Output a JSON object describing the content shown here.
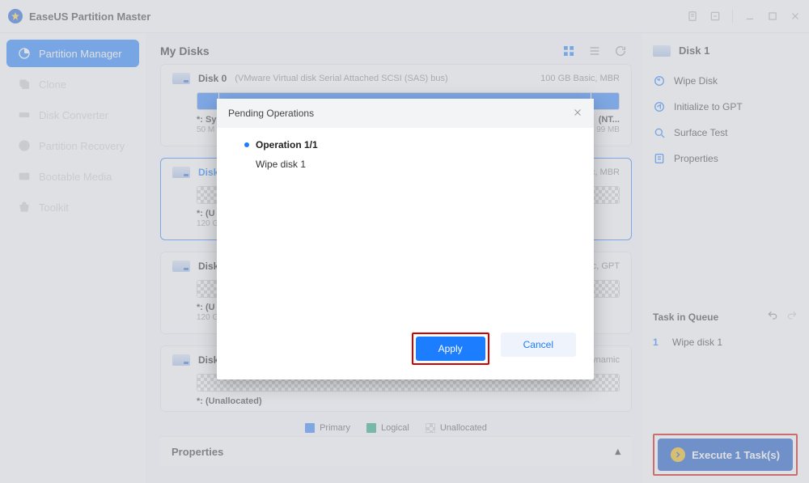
{
  "app": {
    "title": "EaseUS Partition Master"
  },
  "sidebar": {
    "items": [
      {
        "label": "Partition Manager",
        "icon": "pie"
      },
      {
        "label": "Clone",
        "icon": "clone"
      },
      {
        "label": "Disk Converter",
        "icon": "convert"
      },
      {
        "label": "Partition Recovery",
        "icon": "recovery"
      },
      {
        "label": "Bootable Media",
        "icon": "media"
      },
      {
        "label": "Toolkit",
        "icon": "toolkit"
      }
    ]
  },
  "main": {
    "title": "My Disks",
    "disks": [
      {
        "name": "Disk 0",
        "sub": "(VMware   Virtual disk     Serial Attached SCSI (SAS) bus)",
        "meta": "100 GB Basic, MBR",
        "lab1_name": "*: Sy",
        "lab1_size": "50 M",
        "lab2_name": "(NT...",
        "lab2_size": "99 MB"
      },
      {
        "name": "Disk",
        "meta": "sic, MBR",
        "lab1_name": "*: (U",
        "lab1_size": "120 G"
      },
      {
        "name": "Disk",
        "meta": "asic, GPT",
        "lab1_name": "*: (U",
        "lab1_size": "120 G"
      },
      {
        "name": "Disk",
        "meta": "Dynamic",
        "lab1_name": "*: (Unallocated)",
        "lab1_size": ""
      }
    ],
    "legend": {
      "primary": "Primary",
      "logical": "Logical",
      "unalloc": "Unallocated"
    },
    "properties_label": "Properties"
  },
  "right": {
    "title": "Disk 1",
    "actions": [
      {
        "label": "Wipe Disk",
        "icon": "wipe"
      },
      {
        "label": "Initialize to GPT",
        "icon": "init"
      },
      {
        "label": "Surface Test",
        "icon": "surface"
      },
      {
        "label": "Properties",
        "icon": "props"
      }
    ],
    "task_title": "Task in Queue",
    "task": {
      "num": "1",
      "name": "Wipe disk 1"
    },
    "exec_label": "Execute 1 Task(s)"
  },
  "modal": {
    "title": "Pending Operations",
    "op_title": "Operation 1/1",
    "op_line": "Wipe disk 1",
    "apply": "Apply",
    "cancel": "Cancel"
  }
}
